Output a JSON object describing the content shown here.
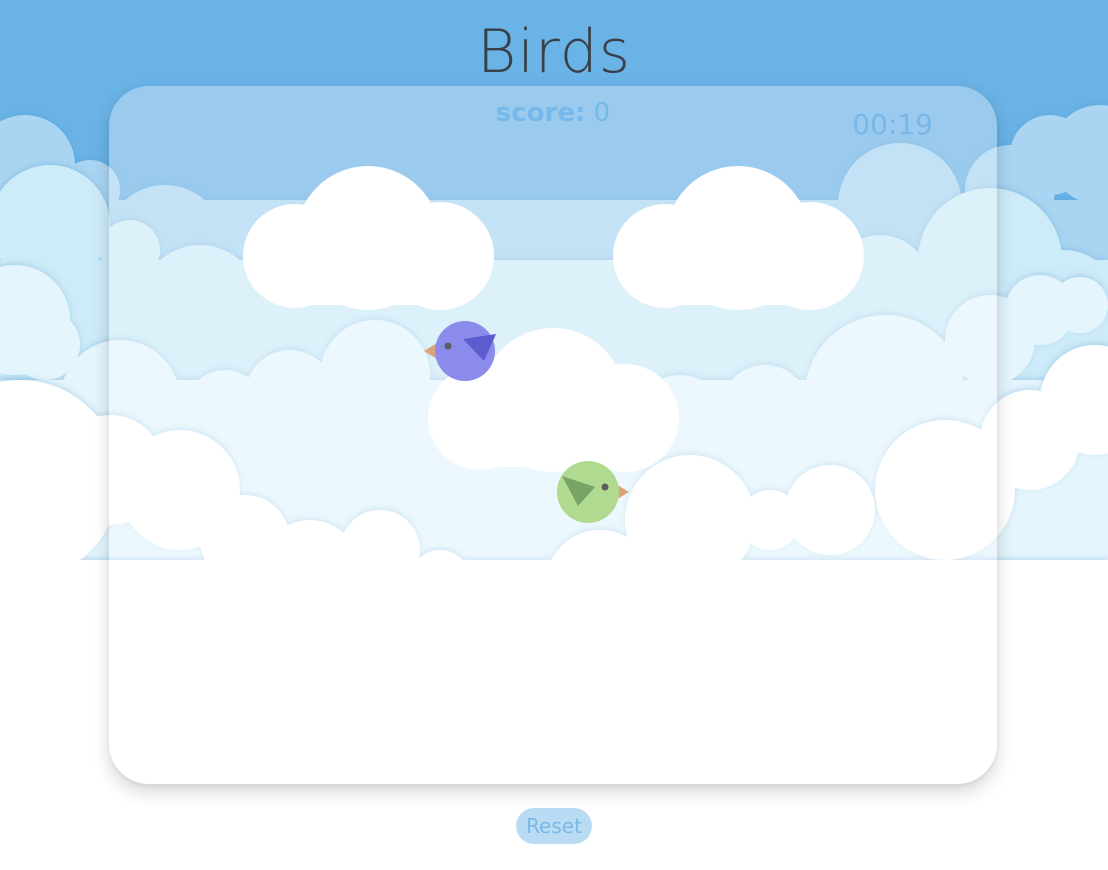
{
  "app": {
    "title": "Birds"
  },
  "hud": {
    "score_label": "score:",
    "score_value": "0",
    "timer": "00:19"
  },
  "controls": {
    "reset_label": "Reset"
  },
  "birds": [
    {
      "name": "blue-bird",
      "facing": "left",
      "body_color": "#5454e4",
      "wing_color": "#1010b8",
      "beak_color": "#c87a3e"
    },
    {
      "name": "green-bird",
      "facing": "right",
      "body_color": "#8bc95a",
      "wing_color": "#3c7a1e",
      "beak_color": "#c87a3e"
    }
  ],
  "colors": {
    "sky": "#6ab3e6",
    "cloud_far": "#a9d5f2",
    "cloud_mid": "#cdebf8",
    "cloud_near": "#e4f5fd",
    "cloud_front": "#ffffff",
    "text_accent": "#76b8ea",
    "title_text": "#3a3f47"
  }
}
